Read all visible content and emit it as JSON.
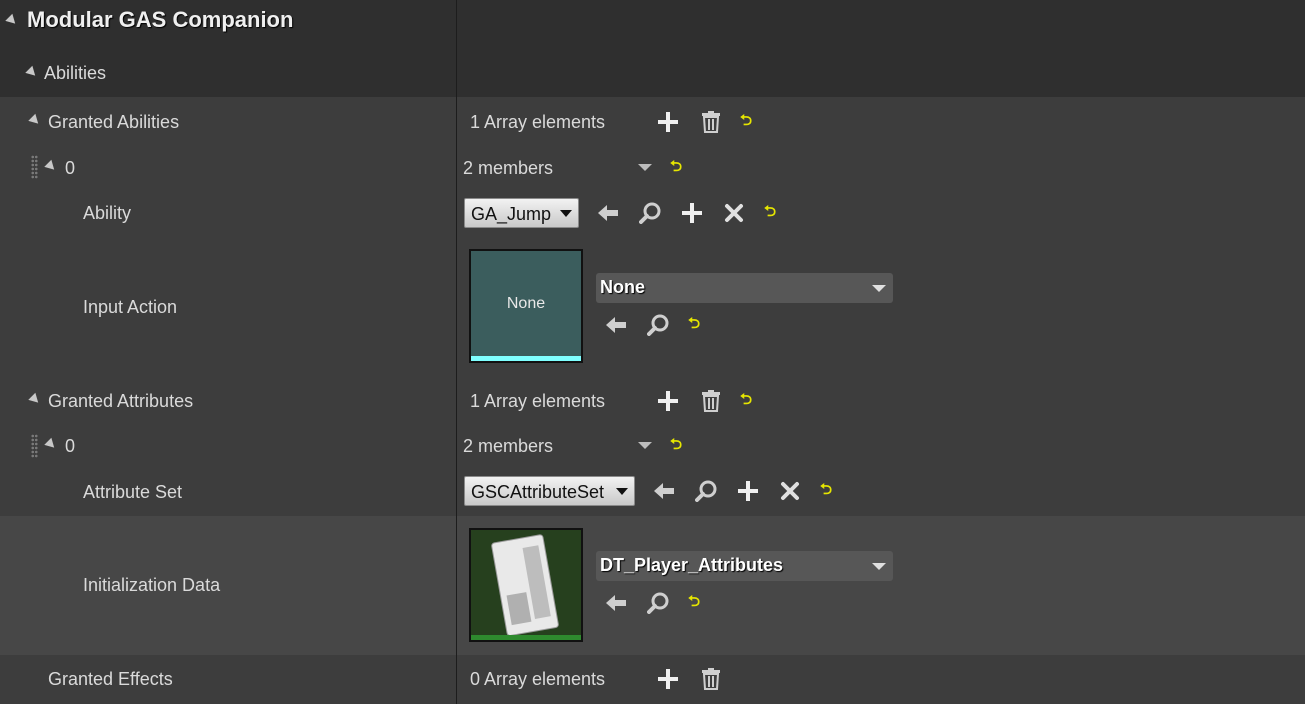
{
  "category": {
    "title": "Modular GAS Companion"
  },
  "section": {
    "label": "Abilities"
  },
  "granted_abilities": {
    "label": "Granted Abilities",
    "count_text": "1 Array elements",
    "element": {
      "index": "0",
      "members_text": "2 members",
      "ability": {
        "label": "Ability",
        "value": "GA_Jump"
      },
      "input_action": {
        "label": "Input Action",
        "thumb_text": "None",
        "value": "None"
      }
    }
  },
  "granted_attributes": {
    "label": "Granted Attributes",
    "count_text": "1 Array elements",
    "element": {
      "index": "0",
      "members_text": "2 members",
      "attribute_set": {
        "label": "Attribute Set",
        "value": "GSCAttributeSet"
      },
      "init_data": {
        "label": "Initialization Data",
        "value": "DT_Player_Attributes"
      }
    }
  },
  "granted_effects": {
    "label": "Granted Effects",
    "count_text": "0 Array elements"
  },
  "colors": {
    "panel_bg": "#2f2f2f",
    "row_bg": "#3d3d3d",
    "highlight_row": "#474747",
    "reset_icon": "#e6e600",
    "input_action_thumb": "#3b5d5d",
    "input_action_bar": "#7fffff",
    "datatable_thumb": "#26401e",
    "datatable_bar": "#2e8a2e"
  },
  "icons": [
    "collapse-triangle-icon",
    "add-icon",
    "trash-icon",
    "reset-to-default-icon",
    "dropdown-arrow-icon",
    "use-selected-icon",
    "browse-icon",
    "clear-icon",
    "grip-icon"
  ]
}
